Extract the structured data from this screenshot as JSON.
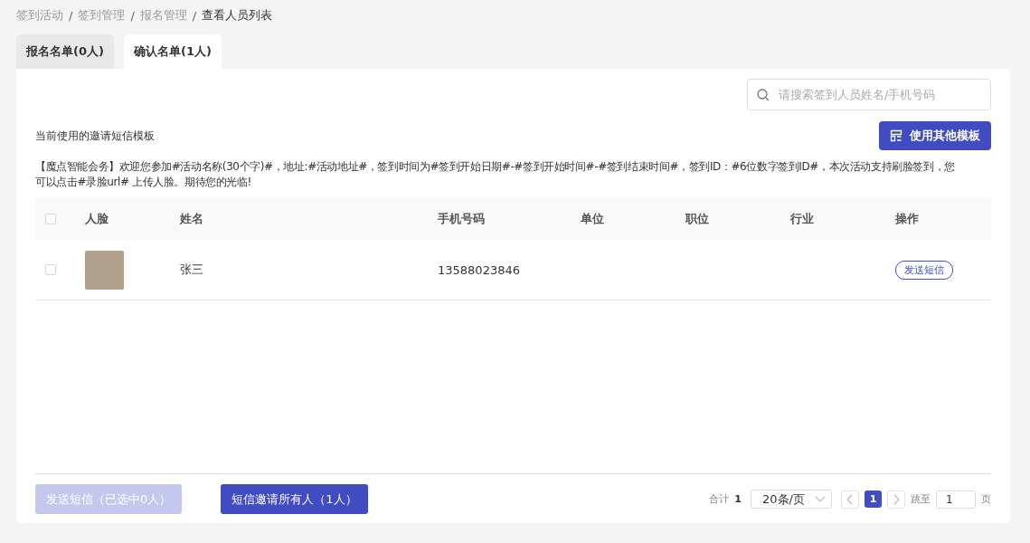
{
  "breadcrumb": [
    {
      "label": "签到活动",
      "current": false
    },
    {
      "label": "签到管理",
      "current": false
    },
    {
      "label": "报名管理",
      "current": false
    },
    {
      "label": "查看人员列表",
      "current": true
    }
  ],
  "breadcrumb_separator": "/",
  "tabs": [
    {
      "label": "报名名单(0人)",
      "selected": false
    },
    {
      "label": "确认名单(1人)",
      "selected": true
    }
  ],
  "search": {
    "placeholder": "请搜索签到人员姓名/手机号码"
  },
  "template_label": "当前使用的邀请短信模板",
  "template_button": "使用其他模板",
  "template_text": "【魔点智能会务】欢迎您参加#活动名称(30个字)#，地址:#活动地址#，签到时间为#签到开始日期#-#签到开始时间#-#签到结束时间#，签到ID：#6位数字签到ID#，本次活动支持刷脸签到，您可以点击#录脸url# 上传人脸。期待您的光临!",
  "table": {
    "select_all_checked": false,
    "columns": [
      "人脸",
      "姓名",
      "手机号码",
      "单位",
      "职位",
      "行业",
      "操作"
    ],
    "rows": [
      {
        "checked": false,
        "name": "张三",
        "phone": "13588023846",
        "action": "发送短信"
      }
    ]
  },
  "footer": {
    "send_button": {
      "label": "发送短信（已选中0人）",
      "disabled": true
    },
    "invite_all_button": {
      "label": "短信邀请所有人（1人）",
      "disabled": false
    }
  },
  "pagination": {
    "total_label": "合计",
    "total": "1",
    "page_size": "20条/页",
    "pages": [
      {
        "label": "1",
        "selected": true
      }
    ],
    "jump_label": "跳至",
    "jump_value": "1",
    "page_suffix": "页"
  }
}
